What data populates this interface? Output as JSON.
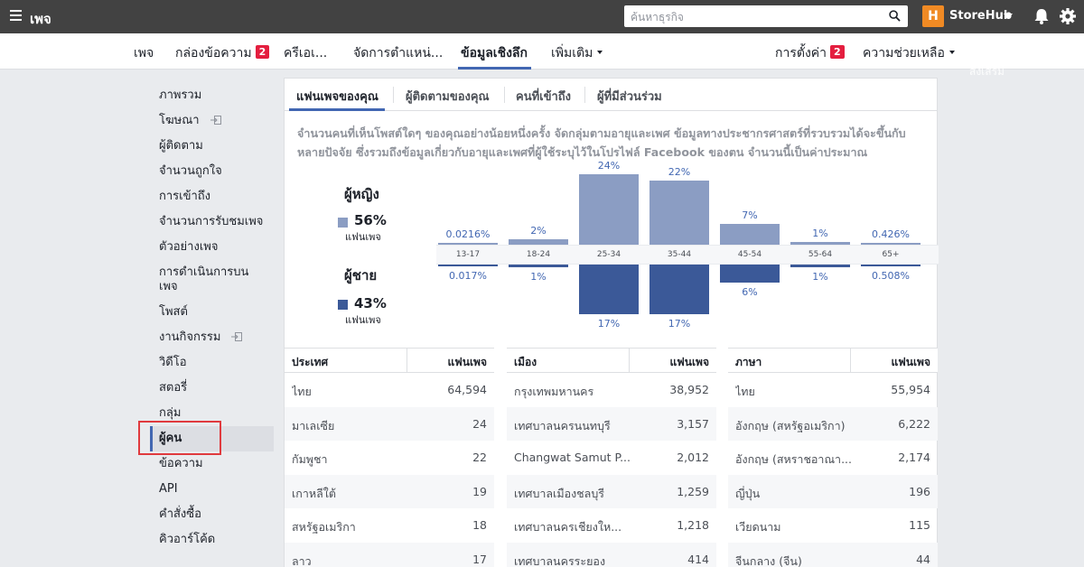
{
  "topbar": {
    "brand": "เพจ",
    "search_placeholder": "ค้นหาธุรกิจ",
    "account_logo": "H",
    "account_name": "StoreHub"
  },
  "nav": {
    "items": [
      {
        "label": "เพจ"
      },
      {
        "label": "กล่องข้อความ",
        "badge": "2"
      },
      {
        "label": "ครีเอเ..."
      },
      {
        "label": "จัดการตำแหน่..."
      },
      {
        "label": "ข้อมูลเชิงลึก"
      },
      {
        "label": "เพิ่มเติม"
      }
    ],
    "settings": "การตั้งค่า",
    "settings_badge": "2",
    "help": "ความช่วยเหลือ",
    "ghost_text": "ส่งเสริม"
  },
  "sidebar": {
    "items": [
      "ภาพรวม",
      "โฆษณา",
      "ผู้ติดตาม",
      "จำนวนถูกใจ",
      "การเข้าถึง",
      "จำนวนการรับชมเพจ",
      "ตัวอย่างเพจ",
      "การดำเนินการบนเพจ",
      "โพสต์",
      "งานกิจกรรม",
      "วิดีโอ",
      "สตอรี่",
      "กลุ่ม",
      "ผู้คน",
      "ข้อความ",
      "API",
      "คำสั่งซื้อ",
      "คิวอาร์โค้ด"
    ]
  },
  "tabs": [
    "แฟนเพจของคุณ",
    "ผู้ติดตามของคุณ",
    "คนที่เข้าถึง",
    "ผู้ที่มีส่วนร่วม"
  ],
  "description": "จำนวนคนที่เห็นโพสต์ใดๆ ของคุณอย่างน้อยหนึ่งครั้ง จัดกลุ่มตามอายุและเพศ ข้อมูลทางประชากรศาสตร์ที่รวบรวมได้จะขึ้นกับหลายปัจจัย ซึ่งรวมถึงข้อมูลเกี่ยวกับอายุและเพศที่ผู้ใช้ระบุไว้ในโปรไฟล์ Facebook ของตน จำนวนนี้เป็นค่าประมาณ",
  "gender": {
    "female_label": "ผู้หญิง",
    "female_pct": "56%",
    "female_sub": "แฟนเพจ",
    "male_label": "ผู้ชาย",
    "male_pct": "43%",
    "male_sub": "แฟนเพจ",
    "female_color": "#8b9dc3",
    "male_color": "#3b5998"
  },
  "chart_data": {
    "type": "bar",
    "categories": [
      "13-17",
      "18-24",
      "25-34",
      "35-44",
      "45-54",
      "55-64",
      "65+"
    ],
    "series": [
      {
        "name": "ผู้หญิง",
        "values": [
          0.0216,
          2,
          24,
          22,
          7,
          1,
          0.426
        ],
        "labels": [
          "0.0216%",
          "2%",
          "24%",
          "22%",
          "7%",
          "1%",
          "0.426%"
        ]
      },
      {
        "name": "ผู้ชาย",
        "values": [
          0.017,
          1,
          17,
          17,
          6,
          1,
          0.508
        ],
        "labels": [
          "0.017%",
          "1%",
          "17%",
          "17%",
          "6%",
          "1%",
          "0.508%"
        ]
      }
    ],
    "ylabel": "",
    "ylim": [
      0,
      24
    ]
  },
  "tables": [
    {
      "col1": "ประเทศ",
      "col2": "แฟนเพจ",
      "rows": [
        [
          "ไทย",
          "64,594"
        ],
        [
          "มาเลเซีย",
          "24"
        ],
        [
          "กัมพูชา",
          "22"
        ],
        [
          "เกาหลีใต้",
          "19"
        ],
        [
          "สหรัฐอเมริกา",
          "18"
        ],
        [
          "ลาว",
          "17"
        ]
      ]
    },
    {
      "col1": "เมือง",
      "col2": "แฟนเพจ",
      "rows": [
        [
          "กรุงเทพมหานคร",
          "38,952"
        ],
        [
          "เทศบาลนครนนทบุรี",
          "3,157"
        ],
        [
          "Changwat Samut P...",
          "2,012"
        ],
        [
          "เทศบาลเมืองชลบุรี",
          "1,259"
        ],
        [
          "เทศบาลนครเชียงให...",
          "1,218"
        ],
        [
          "เทศบาลนครระยอง",
          "414"
        ]
      ]
    },
    {
      "col1": "ภาษา",
      "col2": "แฟนเพจ",
      "rows": [
        [
          "ไทย",
          "55,954"
        ],
        [
          "อังกฤษ (สหรัฐอเมริกา)",
          "6,222"
        ],
        [
          "อังกฤษ (สหราชอาณา...",
          "2,174"
        ],
        [
          "ญี่ปุ่น",
          "196"
        ],
        [
          "เวียดนาม",
          "115"
        ],
        [
          "จีนกลาง (จีน)",
          "44"
        ]
      ]
    }
  ]
}
